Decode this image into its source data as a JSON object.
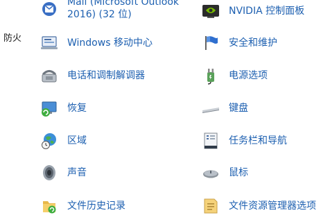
{
  "left_panel": {
    "label": "防火"
  },
  "items": {
    "mail": {
      "line1": "Mail (Microsoft Outlook",
      "line2": "2016) (32 位)"
    },
    "nvidia": {
      "label": "NVIDIA 控制面板"
    },
    "mobility": {
      "label": "Windows 移动中心"
    },
    "security": {
      "label": "安全和维护"
    },
    "phone_modem": {
      "label": "电话和调制解调器"
    },
    "power": {
      "label": "电源选项"
    },
    "recovery": {
      "label": "恢复"
    },
    "keyboard": {
      "label": "键盘"
    },
    "region": {
      "label": "区域"
    },
    "taskbar": {
      "label": "任务栏和导航"
    },
    "sound": {
      "label": "声音"
    },
    "mouse": {
      "label": "鼠标"
    },
    "file_history": {
      "label": "文件历史记录"
    },
    "explorer_options": {
      "label": "文件资源管理器选项"
    }
  },
  "colors": {
    "link": "#1c5fb0",
    "text": "#1a1a1a",
    "background": "#ffffff"
  }
}
